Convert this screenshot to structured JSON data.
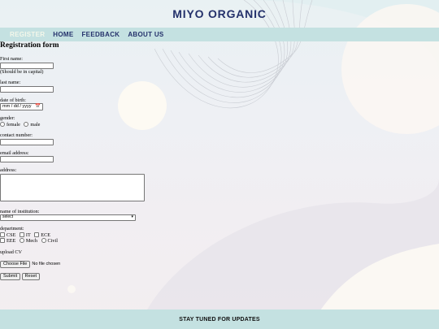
{
  "site": {
    "title": "MIYO ORGANIC"
  },
  "nav": {
    "items": [
      {
        "label": "REGISTER"
      },
      {
        "label": "HOME"
      },
      {
        "label": "FEEDBACK"
      },
      {
        "label": "ABOUT US"
      }
    ]
  },
  "form": {
    "title": "Registration form",
    "first_name_label": "First name:",
    "first_name_note": "(Should be in capital)",
    "last_name_label": "last name:",
    "dob_label": "date of birth:",
    "dob_placeholder": "mm / dd / yyyy",
    "gender_label": "gender:",
    "gender_options": [
      "female",
      "male"
    ],
    "contact_label": "contact number:",
    "email_label": "email address:",
    "address_label": "address:",
    "institution_label": "name of institution:",
    "institution_selected": "select",
    "department_label": "department:",
    "department_options": [
      "CSE",
      "IT",
      "ECE",
      "EEE",
      "Mech",
      "Civil"
    ],
    "cv_label": "upload CV",
    "file_button": "Choose File",
    "file_status": "No file chosen",
    "submit_label": "Submit",
    "reset_label": "Reset"
  },
  "footer": {
    "text": "STAY TUNED FOR UPDATES"
  },
  "colors": {
    "title": "#24316b",
    "nav_bar": "#c4e1e1",
    "active_nav": "#f4f7ea"
  }
}
